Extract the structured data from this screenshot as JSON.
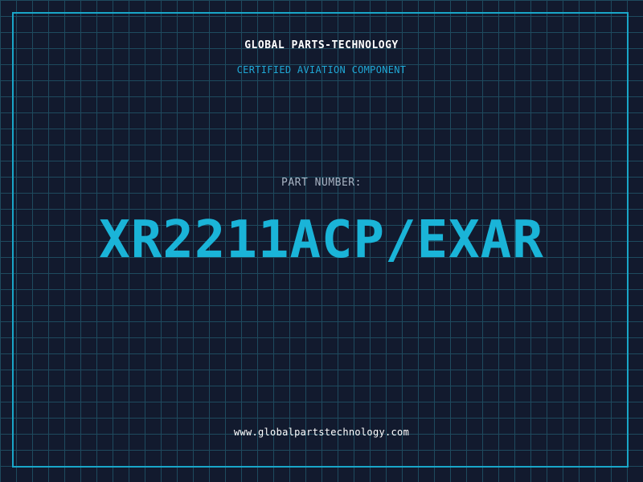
{
  "header": {
    "company": "GLOBAL PARTS-TECHNOLOGY",
    "subtitle": "CERTIFIED AVIATION COMPONENT"
  },
  "part": {
    "label": "PART NUMBER:",
    "number": "XR2211ACP/EXAR"
  },
  "footer": {
    "url": "www.globalpartstechnology.com"
  },
  "colors": {
    "background": "#121a2e",
    "grid": "#1e4a5e",
    "accent": "#1ab4d8",
    "frame": "#19a6c8",
    "label": "#a9b4c4",
    "text": "#ffffff"
  }
}
